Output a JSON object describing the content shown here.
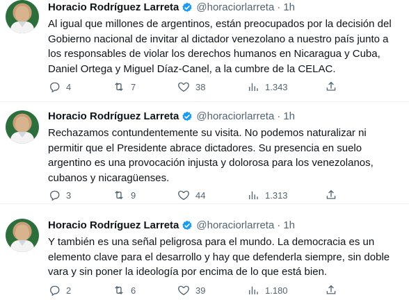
{
  "tweets": [
    {
      "name": "Horacio Rodríguez Larreta",
      "handle": "@horaciorlarreta",
      "dot": "·",
      "time": "1h",
      "text": "Al igual que millones de argentinos, están preocupados por la decisión del Gobierno nacional de invitar al dictador venezolano a nuestro país junto a los responsables de violar los derechos humanos en Nicaragua y Cuba, Daniel Ortega y Miguel Díaz-Canel, a la cumbre de la CELAC.",
      "replies": "4",
      "retweets": "7",
      "likes": "38",
      "views": "1.343"
    },
    {
      "name": "Horacio Rodríguez Larreta",
      "handle": "@horaciorlarreta",
      "dot": "·",
      "time": "1h",
      "text": "Rechazamos contundentemente su visita. No podemos naturalizar ni permitir que el Presidente abrace dictadores. Su presencia en suelo argentino es una provocación injusta y dolorosa para los venezolanos, cubanos y nicaragüenses.",
      "replies": "3",
      "retweets": "9",
      "likes": "44",
      "views": "1.313"
    },
    {
      "name": "Horacio Rodríguez Larreta",
      "handle": "@horaciorlarreta",
      "dot": "·",
      "time": "1h",
      "text": "Y también es una señal peligrosa para el mundo. La democracia es un elemento clave para el desarrollo y hay que defenderla siempre, sin doble vara y sin poner la ideología por encima de lo que está bien.",
      "replies": "2",
      "retweets": "6",
      "likes": "39",
      "views": "1.180"
    }
  ],
  "icons": {
    "verified": "verified-badge-icon",
    "reply": "reply-icon",
    "retweet": "retweet-icon",
    "like": "heart-icon",
    "views": "views-chart-icon",
    "share": "share-icon"
  },
  "colors": {
    "text": "#0f1419",
    "secondary": "#536471",
    "verified": "#1d9bf0",
    "divider": "#eff3f4",
    "avatar_bg": "#2c6f3c"
  }
}
